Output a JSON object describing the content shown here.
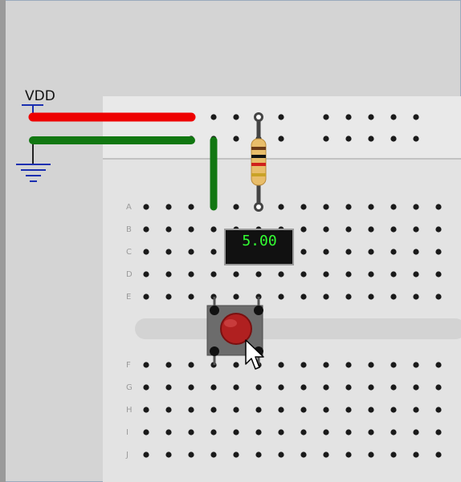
{
  "power": {
    "vdd_label": "VDD"
  },
  "breadboard": {
    "row_labels_top": [
      "A",
      "B",
      "C",
      "D",
      "E"
    ],
    "row_labels_bottom": [
      "F",
      "G",
      "H",
      "I",
      "J"
    ]
  },
  "meter": {
    "reading": "5.00"
  },
  "colors": {
    "canvas_background": "#d2d2d2",
    "board": "#e3e3e3",
    "red_wire": "#ee0000",
    "green_wire": "#117711",
    "meter_text": "#33ff33",
    "button_cap": "#b02020"
  }
}
